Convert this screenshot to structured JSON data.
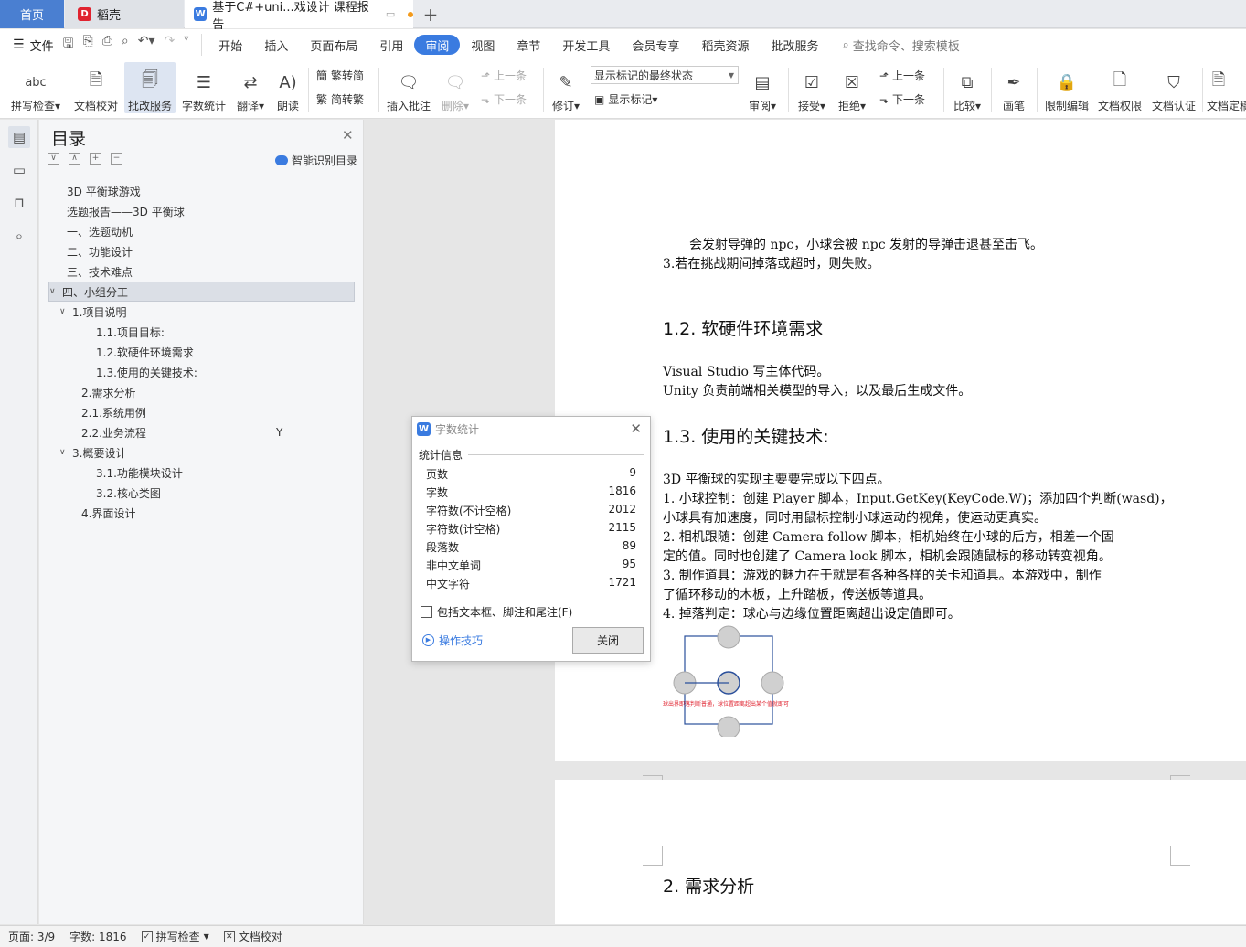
{
  "tabs": {
    "home": "首页",
    "daoke": "稻壳",
    "doc": "基于C#+uni...戏设计 课程报告",
    "new_tab": "+"
  },
  "menu": {
    "file": "文件",
    "items": [
      "开始",
      "插入",
      "页面布局",
      "引用",
      "审阅",
      "视图",
      "章节",
      "开发工具",
      "会员专享",
      "稻壳资源",
      "批改服务"
    ],
    "active": "审阅",
    "search": "查找命令、搜索模板"
  },
  "ribbon": {
    "spell_icon": "abc",
    "spell": "拼写检查",
    "proofread": "文档校对",
    "correction": "批改服务",
    "wordcount": "字数统计",
    "translate": "翻译",
    "read": "朗读",
    "trad": "繁转简",
    "simp": "简转繁",
    "insert_comment": "插入批注",
    "delete": "删除",
    "prev": "上一条",
    "next": "下一条",
    "revise": "修订",
    "markup_select": "显示标记的最终状态",
    "show_markup": "显示标记",
    "review": "审阅",
    "accept": "接受",
    "reject": "拒绝",
    "prev2": "上一条",
    "next2": "下一条",
    "compare": "比较",
    "pen": "画笔",
    "restrict": "限制编辑",
    "permission": "文档权限",
    "certify": "文档认证",
    "finalize": "文档定稿"
  },
  "toc": {
    "title": "目录",
    "smart": "智能识别目录",
    "items": [
      {
        "label": "3D 平衡球游戏"
      },
      {
        "label": "选题报告——3D 平衡球"
      },
      {
        "label": "一、选题动机"
      },
      {
        "label": "二、功能设计"
      },
      {
        "label": "三、技术难点"
      },
      {
        "label": "四、小组分工",
        "arrow": "∨"
      },
      {
        "label": "1.项目说明",
        "arrow": "∨"
      },
      {
        "label": "1.1.项目目标:"
      },
      {
        "label": "1.2.软硬件环境需求"
      },
      {
        "label": "1.3.使用的关键技术:"
      },
      {
        "label": "2.需求分析"
      },
      {
        "label": "2.1.系统用例"
      },
      {
        "label": "2.2.业务流程"
      },
      {
        "label": "3.概要设计",
        "arrow": "∨"
      },
      {
        "label": "3.1.功能模块设计"
      },
      {
        "label": "3.2.核心类图"
      },
      {
        "label": "4.界面设计"
      }
    ],
    "stray_char": "Y"
  },
  "document": {
    "line_top": "会发射导弹的 npc，小球会被 npc 发射的导弹击退甚至击飞。",
    "line_fail": "3.若在挑战期间掉落或超时，则失败。",
    "h_env": "1.2. 软硬件环境需求",
    "env_1": "Visual Studio 写主体代码。",
    "env_2": "Unity 负责前端相关模型的导入，以及最后生成文件。",
    "h_tech": "1.3. 使用的关键技术:",
    "tech_intro": "3D 平衡球的实现主要要完成以下四点。",
    "tech_1a": "1. 小球控制：创建 Player 脚本，Input.GetKey(KeyCode.W)；添加四个判断(wasd)，",
    "tech_1b": "小球具有加速度，同时用鼠标控制小球运动的视角，使运动更真实。",
    "tech_2a": "2. 相机跟随：创建 Camera follow 脚本，相机始终在小球的后方，相差一个固",
    "tech_2b": "定的值。同时也创建了 Camera look 脚本，相机会跟随鼠标的移动转变视角。",
    "tech_3a": "3. 制作道具：游戏的魅力在于就是有各种各样的关卡和道具。本游戏中，制作",
    "tech_3b": "了循环移动的木板，上升踏板，传送板等道具。",
    "tech_4": "4. 掉落判定：球心与边缘位置距离超出设定值即可。",
    "figure_caption": "球出界即落判断普通，球位置距离超出某个值就即可",
    "h_req": "2.  需求分析"
  },
  "dialog": {
    "title": "字数统计",
    "section": "统计信息",
    "stats": [
      {
        "label": "页数",
        "value": "9"
      },
      {
        "label": "字数",
        "value": "1816"
      },
      {
        "label": "字符数(不计空格)",
        "value": "2012"
      },
      {
        "label": "字符数(计空格)",
        "value": "2115"
      },
      {
        "label": "段落数",
        "value": "89"
      },
      {
        "label": "非中文单词",
        "value": "95"
      },
      {
        "label": "中文字符",
        "value": "1721"
      }
    ],
    "include_label": "包括文本框、脚注和尾注(F)",
    "tips": "操作技巧",
    "close": "关闭"
  },
  "status": {
    "page": "页面: 3/9",
    "words": "字数: 1816",
    "spell": "拼写检查",
    "proof": "文档校对"
  },
  "colors": {
    "accent": "#3a7be0",
    "home_tab": "#4a7fd1"
  }
}
